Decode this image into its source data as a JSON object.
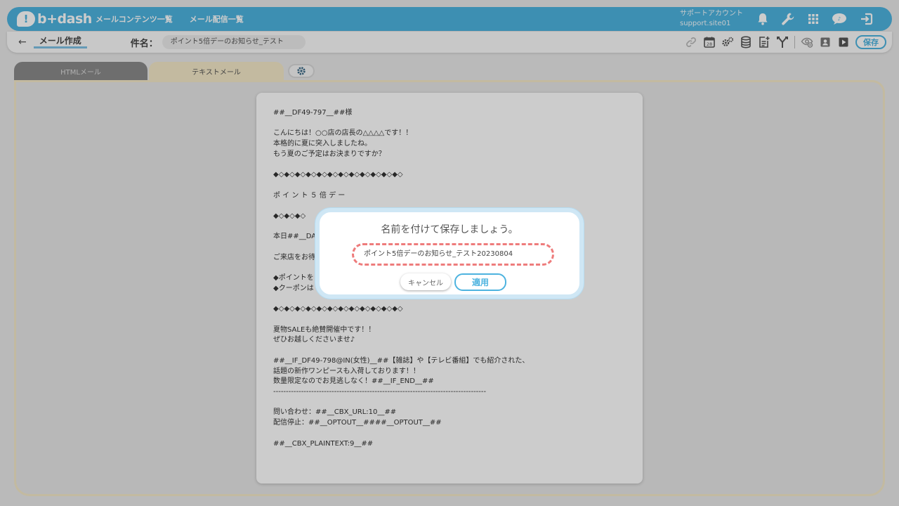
{
  "header": {
    "logo_text": "b+dash",
    "nav": [
      "メールコンテンツ一覧",
      "メール配信一覧"
    ],
    "account_title": "サポートアカウント",
    "account_id": "support.site01",
    "icons": [
      "bell-icon",
      "wrench-icon",
      "grid-icon",
      "chat-icon",
      "logout-icon"
    ]
  },
  "subbar": {
    "back_arrow": "←",
    "breadcrumb": "メール作成",
    "subject_label": "件名：",
    "subject_value": "ポイント5倍デーのお知らせ_テスト",
    "tool_icons": [
      "link-icon",
      "calendar-icon",
      "gears-icon",
      "database-icon",
      "add-document-icon",
      "branch-icon",
      "hide-icon",
      "contact-icon",
      "play-icon"
    ],
    "calendar_day": "28",
    "save_label": "保存"
  },
  "tabs": {
    "html_label": "HTMLメール",
    "text_label": "テキストメール"
  },
  "editor": {
    "body": "##__DF49-797__##様\n\nこんにちは！○○店の店長の△△△△です！！\n本格的に夏に突入しましたね。\nもう夏のご予定はお決まりですか？\n\n◆◇◆◇◆◇◆◇◆◇◆◇◆◇◆◇◆◇◆◇◆◇◆◇\n\nポ イ ン ト ５ 倍 デ ー\n\n◆◇◆◇◆◇\n\n本日##__DAT\n\nご来店をお待\n\n◆ポイントを\n◆クーポンは\n\n◆◇◆◇◆◇◆◇◆◇◆◇◆◇◆◇◆◇◆◇◆◇◆◇\n\n夏物SALEも絶賛開催中です！！\nぜひお越しくださいませ♪\n\n##__IF_DF49-798@IN(女性)__##【雑誌】や【テレビ番組】でも紹介された、\n話題の新作ワンピースも入荷しております！！\n数量限定なのでお見逃しなく！##__IF_END__##\n------------------------------------------------------------------------------------\n\n問い合わせ：##__CBX_URL:10__##\n配信停止：##__OPTOUT__####__OPTOUT__##\n\n##__CBX_PLAINTEXT:9__##"
  },
  "dialog": {
    "title": "名前を付けて保存しましょう。",
    "input_value": "ポイント5倍デーのお知らせ_テスト20230804",
    "cancel_label": "キャンセル",
    "apply_label": "適用"
  },
  "colors": {
    "brand": "#4db3df",
    "tab_active": "#f4e9c8",
    "dashed_highlight": "#ee7c7c"
  }
}
